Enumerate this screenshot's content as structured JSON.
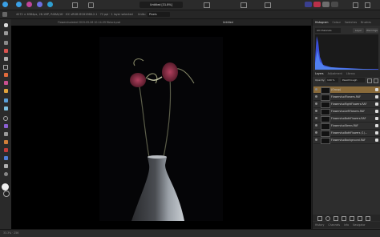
{
  "top": {
    "doc_title": "Untitled [31.8%]",
    "right_btns": [
      "#3a3f8f",
      "#b8304a",
      "#6d6d6d",
      "#4a4a4a"
    ],
    "persona_colors": [
      "#3aa0e6",
      "#c0459b",
      "#6e6ee0",
      "#2e9fd1"
    ]
  },
  "context": {
    "info": "4272 × 6384px, 28.1MP, RGBA/16 · ICC sRGB IEC61966-2.1 · 72 ppi · 1 layer selected",
    "size_label": "Units:",
    "units_value": "Pixels"
  },
  "tabs": {
    "doc1": "FlowersIsolated 2019-05-06 10-14-09 Rblock.psd",
    "doc2": "Untitled"
  },
  "panel": {
    "top_tabs": [
      "Histogram",
      "Colour",
      "Swatches",
      "Brushes"
    ],
    "histogram_channel": "All Channels",
    "layer_btn": "Layer",
    "warn_btn": "Warnings",
    "mid_tabs": [
      "Layers",
      "Adjustment",
      "Library"
    ],
    "opacity_label": "Opacity:",
    "opacity_value": "100 %",
    "blend_mode": "Passthrough",
    "layers": [
      {
        "name": "(Group)",
        "selected": true
      },
      {
        "name": "FlowersIsolFlowers.RAF",
        "selected": false
      },
      {
        "name": "FlowersIsoRightFlowers.RAF",
        "selected": false
      },
      {
        "name": "FlowersIsoLeftFlowers.RAF",
        "selected": false
      },
      {
        "name": "FlowersIsoBothFlowers.RAF",
        "selected": false
      },
      {
        "name": "FlowersIsoStems.RAF",
        "selected": false
      },
      {
        "name": "FlowersIsoBothFlowers (1)...",
        "selected": false
      },
      {
        "name": "FlowersIsoBackground.RAF",
        "selected": false
      }
    ],
    "bottom_tabs": [
      "History",
      "Channels",
      "Info",
      "Navigator"
    ]
  },
  "status": {
    "text": "33.3% · 256"
  }
}
